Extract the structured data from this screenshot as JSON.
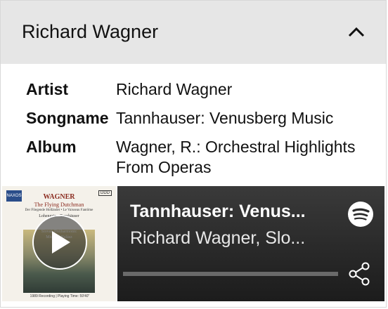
{
  "header": {
    "title": "Richard Wagner",
    "collapse_icon": "chevron-up-icon"
  },
  "info": {
    "rows": [
      {
        "key": "Artist",
        "value": "Richard Wagner"
      },
      {
        "key": "Songname",
        "value": "Tannhauser: Venusberg Music"
      },
      {
        "key": "Album",
        "value": "Wagner, R.: Orchestral Highlights From Operas"
      }
    ]
  },
  "player": {
    "album_art": {
      "composer": "WAGNER",
      "title": "The Flying Dutchman",
      "line1": "Der Fliegende Holländer • Le Vaisseau Fantôme",
      "line2": "Lohengrin • Tannhäuser",
      "performers1": "Slovak Philharmonic",
      "performers2": "Michael Halász",
      "footer": "1989 Recording | Playing Time: 59'40\"",
      "label": "NAXOS",
      "catalog": "DDD",
      "play_icon": "play-icon"
    },
    "track_title": "Tannhauser: Venus...",
    "track_artist": "Richard Wagner, Slo...",
    "progress": 0.0,
    "brand_icon": "spotify-icon",
    "share_icon": "share-icon"
  },
  "colors": {
    "header_bg": "#e6e6e6",
    "player_bg": "#2a2a2a",
    "spotify_icon": "#ffffff"
  }
}
